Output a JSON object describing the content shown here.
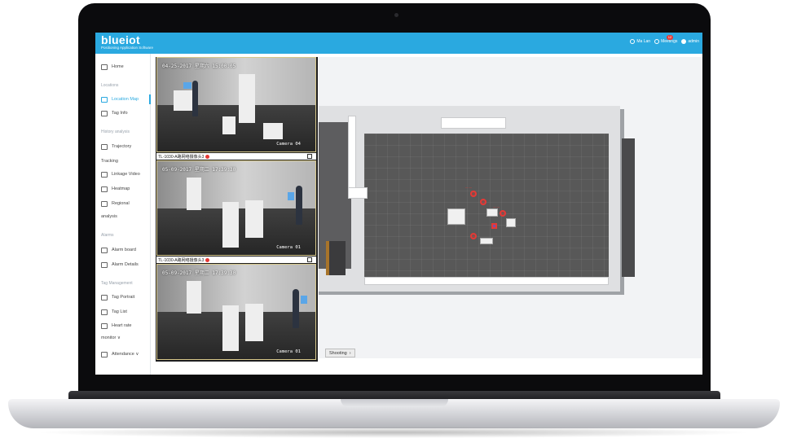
{
  "app": {
    "logo": "blueiot",
    "tagline": "Positioning Application Software"
  },
  "topbar": {
    "items": [
      {
        "icon": "user-ring-icon",
        "label": "Ma Lan"
      },
      {
        "icon": "bell-ring-icon",
        "label": "Meetings"
      },
      {
        "icon": "user-dot-icon",
        "label": "admin"
      }
    ],
    "badge_count": "12"
  },
  "sidebar": {
    "home": "Home",
    "sections": {
      "locations": "Locations",
      "history": "History analysis",
      "alarms": "Alarms",
      "tag_mgmt": "Tag Management"
    },
    "items": {
      "location_map": "Location Map",
      "tag_info": "Tag Info",
      "trajectory": "Trajectory",
      "tracking": "Tracking",
      "linkage_video": "Linkage Video",
      "heatmap": "Heatmap",
      "regional": "Regional",
      "analysis": "analysis",
      "alarm_board": "Alarm board",
      "alarm_details": "Alarm Details",
      "tag_portrait": "Tag Portrait",
      "tag_list": "Tag List",
      "heart_rate": "Heart rate",
      "monitor": "monitor ∨",
      "attendance": "Attendance ∨"
    }
  },
  "cameras": [
    {
      "timestamp": "04-25-2017 星期六 15:00:05",
      "label": "Camera 04",
      "bar": "TL-1030-A路网络摄像头3"
    },
    {
      "timestamp": "05-09-2017 星期二 17:39:30",
      "label": "Camera 01",
      "bar": "TL-1030-A路网络摄像头3"
    },
    {
      "timestamp": "05-09-2017 星期二 17:39:30",
      "label": "Camera 01"
    }
  ],
  "map": {
    "shooting_label": "Shooting"
  },
  "colors": {
    "accent": "#2aa9e0",
    "alert": "#e53935"
  }
}
